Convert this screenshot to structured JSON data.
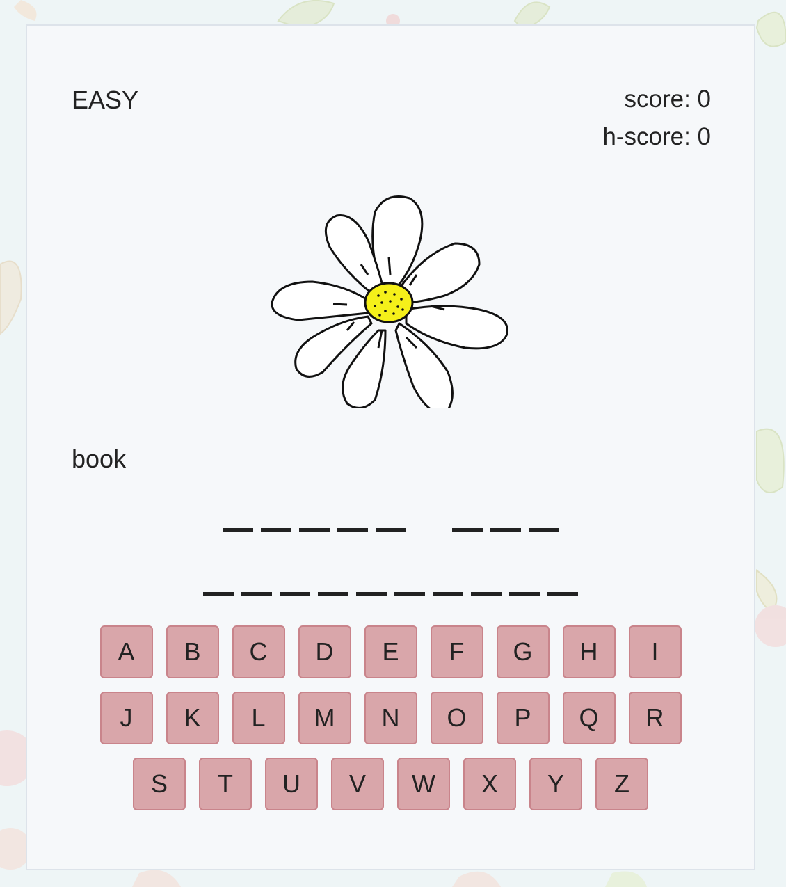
{
  "header": {
    "difficulty": "EASY",
    "score": "score: 0",
    "high_score": "h-score: 0"
  },
  "hint": "book",
  "puzzle": {
    "rows": [
      [
        5,
        3
      ],
      [
        10
      ]
    ]
  },
  "keyboard": {
    "rows": [
      [
        "A",
        "B",
        "C",
        "D",
        "E",
        "F",
        "G",
        "H",
        "I"
      ],
      [
        "J",
        "K",
        "L",
        "M",
        "N",
        "O",
        "P",
        "Q",
        "R"
      ],
      [
        "S",
        "T",
        "U",
        "V",
        "W",
        "X",
        "Y",
        "Z"
      ]
    ]
  },
  "colors": {
    "key_fill": "#d9a6aa",
    "key_border": "#c9848b",
    "flower_center": "#f5f01a",
    "card_bg": "#f6f8fa"
  }
}
